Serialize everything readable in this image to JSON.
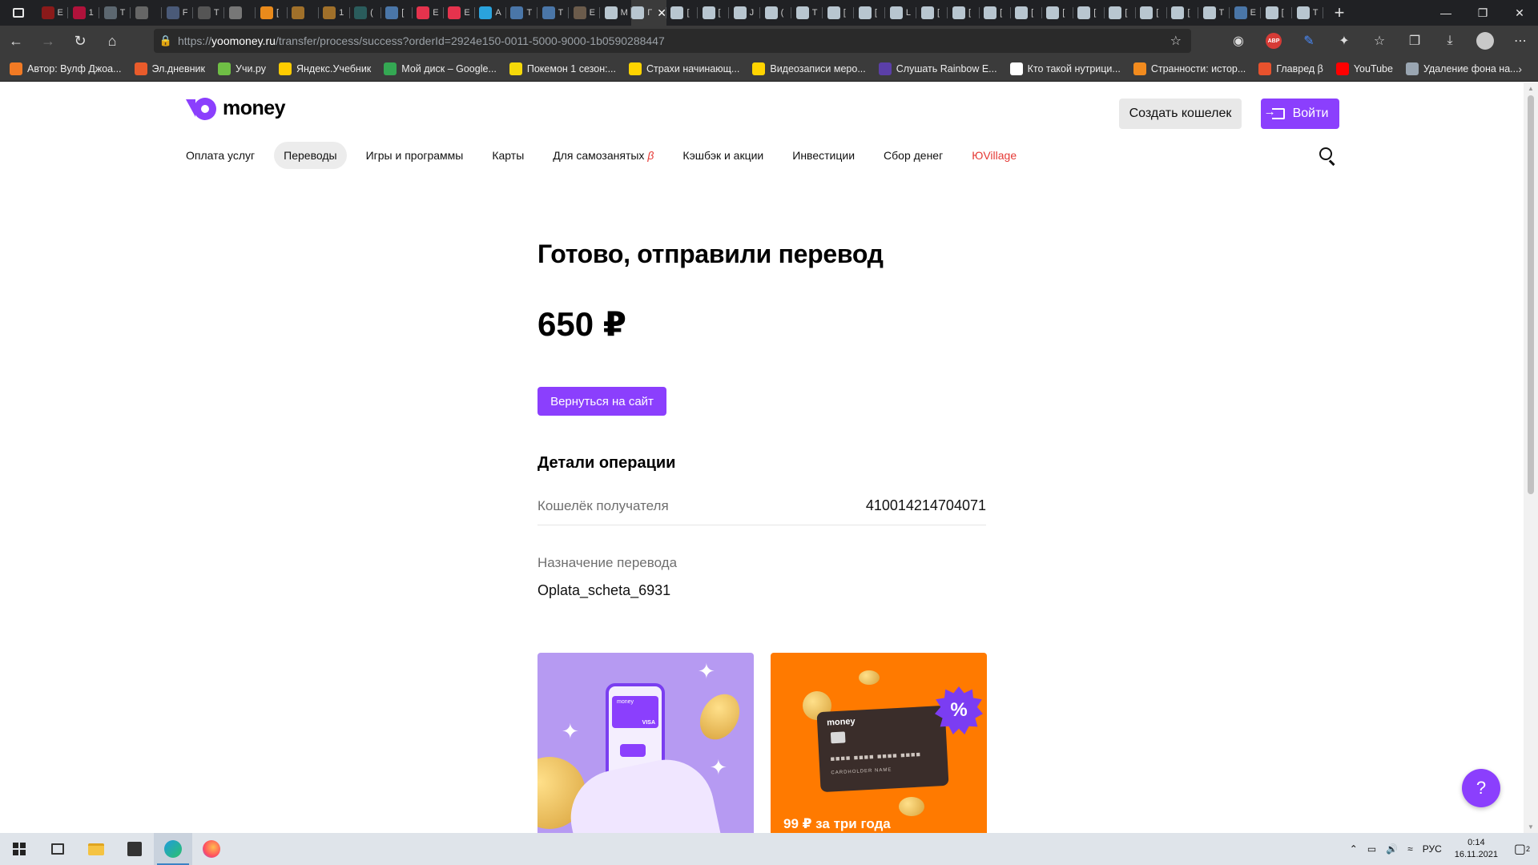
{
  "browser": {
    "tabs": [
      {
        "color": "#8b1a1a",
        "label": "E"
      },
      {
        "color": "#b0123b",
        "label": "1"
      },
      {
        "color": "#5c6770",
        "label": "T"
      },
      {
        "color": "#666666",
        "label": ""
      },
      {
        "color": "#4a5a78",
        "label": "F"
      },
      {
        "color": "#555555",
        "label": "T"
      },
      {
        "color": "#777777",
        "label": ""
      },
      {
        "color": "#e98a1b",
        "label": "["
      },
      {
        "color": "#a0702a",
        "label": ""
      },
      {
        "color": "#a0702a",
        "label": "1"
      },
      {
        "color": "#2a5c5c",
        "label": "("
      },
      {
        "color": "#4a76a8",
        "label": "["
      },
      {
        "color": "#e5334d",
        "label": "E"
      },
      {
        "color": "#e5334d",
        "label": "E"
      },
      {
        "color": "#2aa3dd",
        "label": "A"
      },
      {
        "color": "#4a76a8",
        "label": "T"
      },
      {
        "color": "#4a76a8",
        "label": "T"
      },
      {
        "color": "#6b5b4b",
        "label": "E"
      },
      {
        "color": "#b8c6d0",
        "label": "M"
      },
      {
        "color": "#b8c6d0",
        "label": "Г",
        "active": true
      },
      {
        "color": "#b8c6d0",
        "label": "["
      },
      {
        "color": "#b8c6d0",
        "label": "["
      },
      {
        "color": "#b8c6d0",
        "label": "J"
      },
      {
        "color": "#b8c6d0",
        "label": "("
      },
      {
        "color": "#b8c6d0",
        "label": "T"
      },
      {
        "color": "#b8c6d0",
        "label": "["
      },
      {
        "color": "#b8c6d0",
        "label": "["
      },
      {
        "color": "#b8c6d0",
        "label": "L"
      },
      {
        "color": "#b8c6d0",
        "label": "["
      },
      {
        "color": "#b8c6d0",
        "label": "["
      },
      {
        "color": "#b8c6d0",
        "label": "["
      },
      {
        "color": "#b8c6d0",
        "label": "["
      },
      {
        "color": "#b8c6d0",
        "label": "["
      },
      {
        "color": "#b8c6d0",
        "label": "["
      },
      {
        "color": "#b8c6d0",
        "label": "["
      },
      {
        "color": "#b8c6d0",
        "label": "["
      },
      {
        "color": "#b8c6d0",
        "label": "["
      },
      {
        "color": "#b8c6d0",
        "label": "T"
      },
      {
        "color": "#4a76a8",
        "label": "E"
      },
      {
        "color": "#b8c6d0",
        "label": "["
      },
      {
        "color": "#b8c6d0",
        "label": "T"
      }
    ],
    "new_tab": "+",
    "window_controls": {
      "minimize": "—",
      "restore": "❐",
      "close": "✕"
    },
    "url_prefix": "https://",
    "url_host": "yoomoney.ru",
    "url_path": "/transfer/process/success?orderId=2924e150-0011-5000-9000-1b0590288447",
    "abp_label": "ABP",
    "bookmarks": [
      {
        "label": "Автор: Вулф Джоа...",
        "color": "#f27a24"
      },
      {
        "label": "Эл.дневник",
        "color": "#e95b2b"
      },
      {
        "label": "Учи.ру",
        "color": "#6fbf45"
      },
      {
        "label": "Яндекс.Учебник",
        "color": "#ffcc00"
      },
      {
        "label": "Мой диск – Google...",
        "color": "#34a853"
      },
      {
        "label": "Покемон 1 сезон:...",
        "color": "#f5d90a"
      },
      {
        "label": "Страхи начинающ...",
        "color": "#ffd400"
      },
      {
        "label": "Видеозаписи меро...",
        "color": "#ffd400"
      },
      {
        "label": "Слушать Rainbow E...",
        "color": "#5b3fa8"
      },
      {
        "label": "Кто такой нутрици...",
        "color": "#ffffff"
      },
      {
        "label": "Странности: истор...",
        "color": "#f28b1e"
      },
      {
        "label": "Главред β",
        "color": "#e8522d"
      },
      {
        "label": "YouTube",
        "color": "#ff0000"
      },
      {
        "label": "Удаление фона на...",
        "color": "#9aa6b2"
      }
    ]
  },
  "site": {
    "logo_text": "money",
    "create_wallet": "Создать кошелек",
    "login": "Войти",
    "nav": [
      {
        "label": "Оплата услуг"
      },
      {
        "label": "Переводы",
        "active": true
      },
      {
        "label": "Игры и программы"
      },
      {
        "label": "Карты"
      },
      {
        "label": "Для самозанятых",
        "beta": "β"
      },
      {
        "label": "Кэшбэк и акции"
      },
      {
        "label": "Инвестиции"
      },
      {
        "label": "Сбор денег"
      },
      {
        "label": "ЮVillage",
        "red": true
      }
    ]
  },
  "result": {
    "title": "Готово, отправили перевод",
    "amount": "650 ₽",
    "back_button": "Вернуться на сайт",
    "details_title": "Детали операции",
    "wallet_label": "Кошелёк получателя",
    "wallet_value": "410014214704071",
    "purpose_label": "Назначение перевода",
    "purpose_value": "Oplata_scheta_6931"
  },
  "promo": {
    "card1_brand": "money",
    "card1_badge": "VISA",
    "card2_brand": "money",
    "card2_holder": "CARDHOLDER NAME",
    "card2_number": "■■■■ ■■■■ ■■■■ ■■■■",
    "card2_percent": "%",
    "card2_text": "99 ₽ за три года"
  },
  "help_label": "?",
  "taskbar": {
    "lang": "РУС",
    "time": "0:14",
    "date": "16.11.2021",
    "notifications": "2"
  },
  "colors": {
    "accent": "#8b3ffd",
    "promo_orange": "#ff7a00",
    "promo_purple": "#b69af2"
  }
}
